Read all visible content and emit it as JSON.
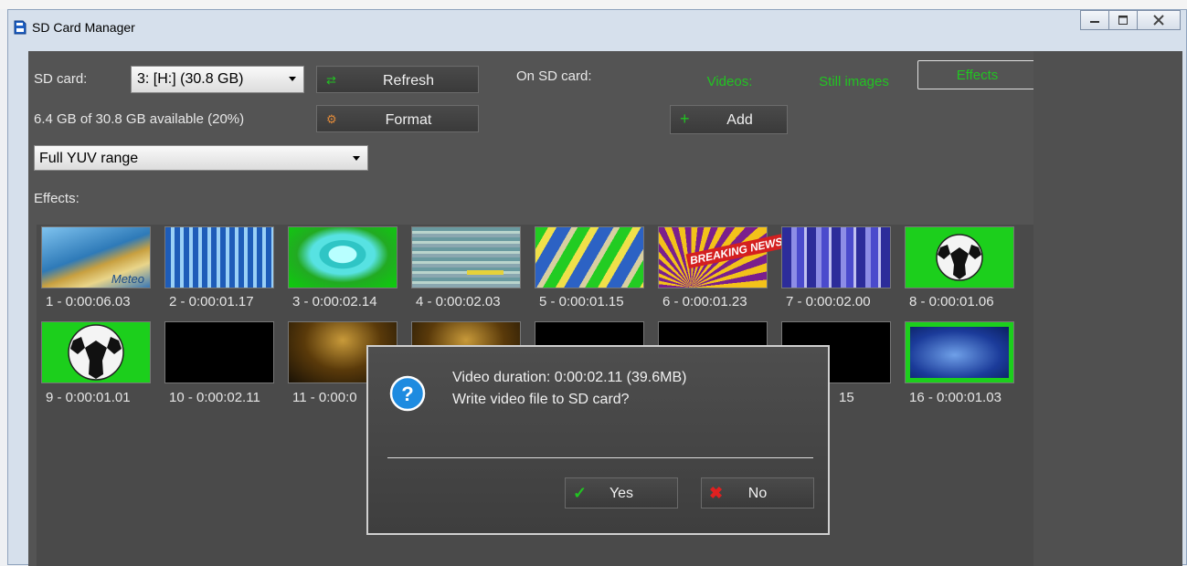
{
  "window": {
    "title": "SD Card Manager"
  },
  "sdcard": {
    "label": "SD card:",
    "selected": "3: [H:] (30.8 GB)",
    "refresh_label": "Refresh",
    "format_label": "Format",
    "available_text": "6.4 GB of 30.8 GB available (20%)",
    "yuv_selected": "Full YUV range"
  },
  "on_card": {
    "label": "On SD card:",
    "tabs": [
      "Videos:",
      "Still images",
      "Effects"
    ],
    "active_tab": "Effects",
    "add_label": "Add"
  },
  "effects": {
    "label": "Effects:",
    "items": [
      "1 - 0:00:06.03",
      "2 - 0:00:01.17",
      "3 - 0:00:02.14",
      "4 - 0:00:02.03",
      "5 - 0:00:01.15",
      "6 - 0:00:01.23",
      "7 - 0:00:02.00",
      "8 - 0:00:01.06",
      "9 - 0:00:01.01",
      "10 - 0:00:02.11",
      "11 - 0:00:0",
      "15",
      "16 - 0:00:01.03"
    ],
    "thumb_texts": {
      "meteo": "Meteo",
      "breaking": "BREAKING NEWS"
    }
  },
  "dialog": {
    "line1": "Video duration: 0:00:02.11 (39.6MB)",
    "line2": "Write video file to SD card?",
    "yes_label": "Yes",
    "no_label": "No"
  },
  "colors": {
    "accent_green": "#22c322",
    "panel": "#545454",
    "dialog_bg": "#464646"
  }
}
